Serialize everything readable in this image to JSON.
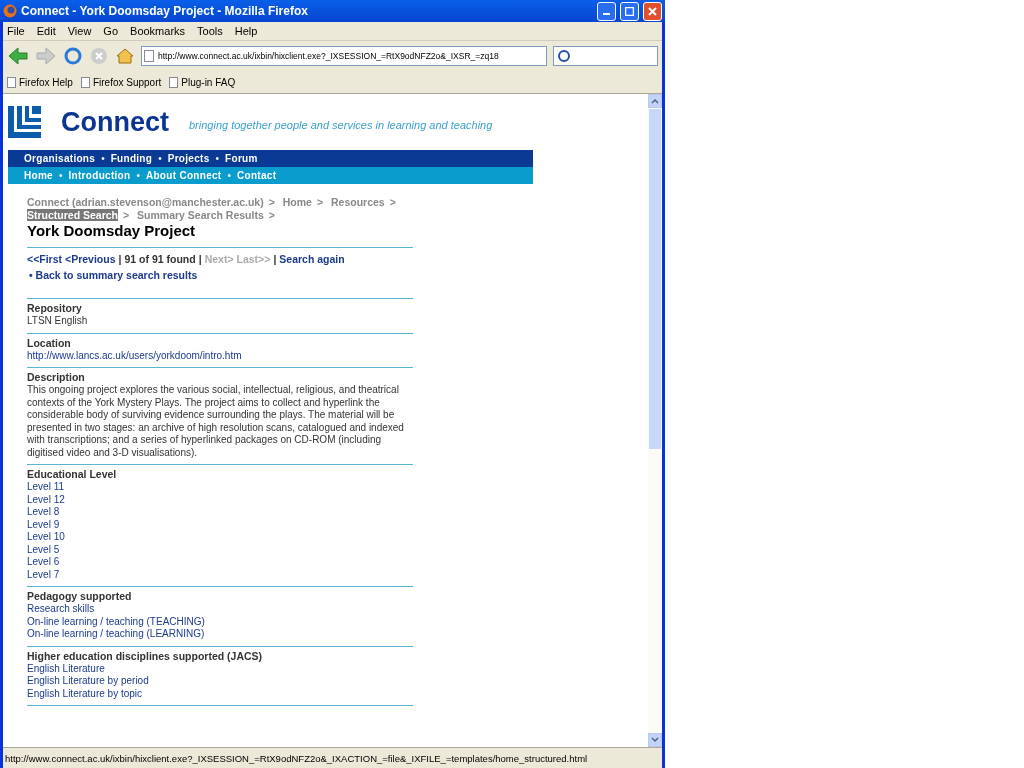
{
  "window": {
    "title": "Connect - York Doomsday Project - Mozilla Firefox"
  },
  "menu": [
    "File",
    "Edit",
    "View",
    "Go",
    "Bookmarks",
    "Tools",
    "Help"
  ],
  "address_bar": {
    "value": "http://www.connect.ac.uk/ixbin/hixclient.exe?_IXSESSION_=RtX9odNFZ2o&_IXSR_=zq18"
  },
  "bookmarks": [
    "Firefox Help",
    "Firefox Support",
    "Plug-in FAQ"
  ],
  "site": {
    "logo": "Connect",
    "tagline": "bringing together people and services in learning and teaching",
    "nav_primary": [
      "Organisations",
      "Funding",
      "Projects",
      "Forum"
    ],
    "nav_secondary": [
      "Home",
      "Introduction",
      "About Connect",
      "Contact"
    ],
    "nav_separator": "•",
    "breadcrumb": [
      {
        "label": "Connect (adrian.stevenson@manchester.ac.uk)",
        "selected": false
      },
      {
        "label": "Home",
        "selected": false
      },
      {
        "label": "Resources",
        "selected": false
      },
      {
        "label": "Structured Search",
        "selected": true
      },
      {
        "label": "Summary Search Results",
        "selected": false
      }
    ],
    "breadcrumb_separator": ">",
    "heading": "York Doomsday Project",
    "pager": [
      {
        "kind": "link",
        "label": "<<First",
        "disabled": false
      },
      {
        "kind": "link",
        "label": "<Previous",
        "disabled": false
      },
      {
        "kind": "sep",
        "label": "|"
      },
      {
        "kind": "text",
        "label": "91 of 91 found"
      },
      {
        "kind": "sep",
        "label": "|"
      },
      {
        "kind": "link",
        "label": "Next>",
        "disabled": true
      },
      {
        "kind": "link",
        "label": "Last>>",
        "disabled": true
      },
      {
        "kind": "sep",
        "label": "|"
      },
      {
        "kind": "link",
        "label": "Search again",
        "disabled": false
      }
    ],
    "back_link": "• Back to summary search results",
    "sections": [
      {
        "heading": "Repository",
        "kind": "text",
        "items": [
          "LTSN English"
        ]
      },
      {
        "heading": "Location",
        "kind": "link",
        "items": [
          "http://www.lancs.ac.uk/users/yorkdoom/intro.htm"
        ]
      },
      {
        "heading": "Description",
        "kind": "text",
        "items": [
          "This ongoing project explores the various social, intellectual, religious, and theatrical contexts of the York Mystery Plays. The project aims to collect and hyperlink the considerable body of surviving evidence surrounding the plays. The material will be presented in two stages: an archive of high resolution scans, catalogued and indexed with transcriptions; and a series of hyperlinked packages on CD-ROM (including digitised video and 3-D visualisations)."
        ]
      },
      {
        "heading": "Educational Level",
        "kind": "link",
        "items": [
          "Level 11",
          "Level 12",
          "Level 8",
          "Level 9",
          "Level 10",
          "Level 5",
          "Level 6",
          "Level 7"
        ]
      },
      {
        "heading": "Pedagogy supported",
        "kind": "link",
        "items": [
          "Research skills",
          "On-line learning / teaching (TEACHING)",
          "On-line learning / teaching (LEARNING)"
        ]
      },
      {
        "heading": "Higher education disciplines supported (JACS)",
        "kind": "link",
        "items": [
          "English Literature",
          "English Literature by period",
          "English Literature by topic"
        ]
      }
    ]
  },
  "status_bar": "http://www.connect.ac.uk/ixbin/hixclient.exe?_IXSESSION_=RtX9odNFZ2o&_IXACTION_=file&_IXFILE_=templates/home_structured.html"
}
